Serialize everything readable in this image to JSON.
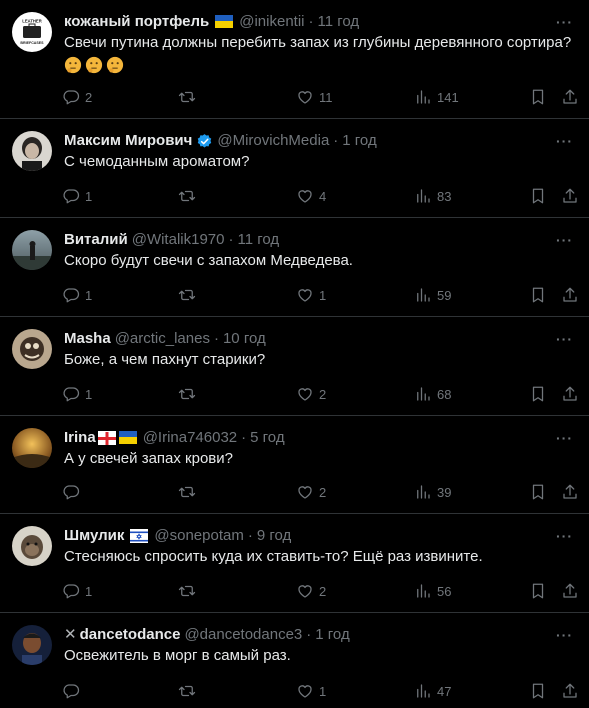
{
  "tweets": [
    {
      "name": "кожаный портфель",
      "handle": "@inikentii",
      "time": "11 год",
      "text": "Свечи путина должны перебить запах из глубины деревянного сортира?",
      "replies": "2",
      "retweets": "",
      "likes": "11",
      "views": "141",
      "avatar_logo": [
        "LEATHER",
        "BRIEFCASES"
      ]
    },
    {
      "name": "Максим Мирович",
      "handle": "@MirovichMedia",
      "time": "1 год",
      "text": "С чемоданным ароматом?",
      "replies": "1",
      "retweets": "",
      "likes": "4",
      "views": "83"
    },
    {
      "name": "Виталий",
      "handle": "@Witalik1970",
      "time": "11 год",
      "text": "Скоро будут свечи с запахом Медведева.",
      "replies": "1",
      "retweets": "",
      "likes": "1",
      "views": "59"
    },
    {
      "name": "Masha",
      "handle": "@arctic_lanes",
      "time": "10 год",
      "text": "Боже, а чем пахнут старики?",
      "replies": "1",
      "retweets": "",
      "likes": "2",
      "views": "68"
    },
    {
      "name": "Irina",
      "handle": "@Irina746032",
      "time": "5 год",
      "text": "А у свечей запах крови?",
      "replies": "",
      "retweets": "",
      "likes": "2",
      "views": "39"
    },
    {
      "name": "Шмулик",
      "handle": "@sonepotam",
      "time": "9 год",
      "text": "Стесняюсь спросить куда их ставить-то? Ещё раз извините.",
      "replies": "1",
      "retweets": "",
      "likes": "2",
      "views": "56"
    },
    {
      "name": "dancetodance",
      "handle": "@dancetodance3",
      "time": "1 год",
      "text": "Освежитель в морг в самый раз.",
      "replies": "",
      "retweets": "",
      "likes": "1",
      "views": "47"
    }
  ],
  "ui": {
    "dot": "·",
    "more": "···",
    "x_mark": "✕"
  },
  "colors": {
    "background": "#000000",
    "text": "#e7e9ea",
    "muted": "#71767b",
    "border": "#2f3336",
    "verified": "#1d9bf0"
  },
  "icons": [
    "reply-icon",
    "retweet-icon",
    "like-icon",
    "views-icon",
    "bookmark-icon",
    "share-icon",
    "more-icon",
    "verified-icon",
    "thinking-face-emoji",
    "flag-ukraine",
    "flag-georgia",
    "flag-israel"
  ]
}
